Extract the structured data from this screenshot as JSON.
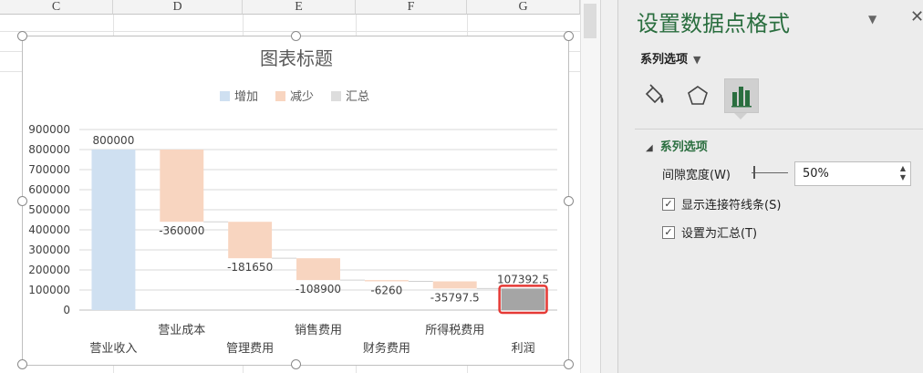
{
  "sheet": {
    "columns": [
      "C",
      "D",
      "E",
      "F",
      "G"
    ]
  },
  "chart_data": {
    "type": "waterfall",
    "title": "图表标题",
    "legend": [
      "增加",
      "减少",
      "汇总"
    ],
    "legend_placement": "top",
    "categories": [
      "营业收入",
      "营业成本",
      "管理费用",
      "销售费用",
      "财务费用",
      "所得税费用",
      "利润"
    ],
    "values": [
      800000,
      -360000,
      -181650,
      -108900,
      -6260,
      -35797.5,
      107392.5
    ],
    "value_labels": [
      "800000",
      "-360000",
      "-181650",
      "-108900",
      "-6260",
      "-35797.5",
      "107392.5"
    ],
    "kinds": [
      "increase",
      "decrease",
      "decrease",
      "decrease",
      "decrease",
      "decrease",
      "total"
    ],
    "y_ticks": [
      "0",
      "100000",
      "200000",
      "300000",
      "400000",
      "500000",
      "600000",
      "700000",
      "800000",
      "900000"
    ],
    "ylim": [
      0,
      900000
    ],
    "grid": true,
    "colors": {
      "increase": "#cfe0f1",
      "decrease": "#f8d5c0",
      "total": "#a5a5a5",
      "legend_total": "#dddddd",
      "highlight": "#e53935"
    }
  },
  "panel": {
    "title": "设置数据点格式",
    "series_dropdown": "系列选项",
    "tabs": [
      {
        "icon": "paint-bucket-icon",
        "label": ""
      },
      {
        "icon": "pentagon-icon",
        "label": ""
      },
      {
        "icon": "bar-chart-icon",
        "label": ""
      }
    ],
    "section": "系列选项",
    "gap_label": "间隙宽度(W)",
    "gap_value": "50%",
    "show_connector": "显示连接符线条(S)",
    "set_as_total": "设置为汇总(T)",
    "accent": "#2a6e3f"
  }
}
